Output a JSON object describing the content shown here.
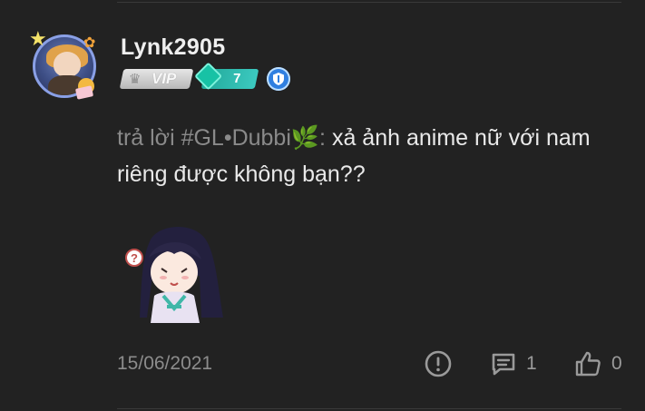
{
  "user": {
    "name": "Lynk2905",
    "vip_label": "VIP",
    "level": "7"
  },
  "comment": {
    "reply_prefix": "trả lời #GL•Dubbi",
    "reply_emoji": "🌿",
    "reply_colon": ":",
    "text": " xả ảnh anime nữ với nam riêng được không bạn??"
  },
  "sticker": {
    "icon": "anime-girl-question-sticker"
  },
  "footer": {
    "date": "15/06/2021",
    "comment_count": "1",
    "like_count": "0"
  },
  "icons": {
    "report": "exclamation-circle-icon",
    "comments": "message-square-icon",
    "like": "thumbs-up-icon",
    "badge": "shield-icon"
  },
  "colors": {
    "background": "#222222",
    "text": "#e9e9e9",
    "muted": "#8c8c8c",
    "level_badge": "#2fb8ad",
    "shield_badge": "#2f7fe0"
  }
}
